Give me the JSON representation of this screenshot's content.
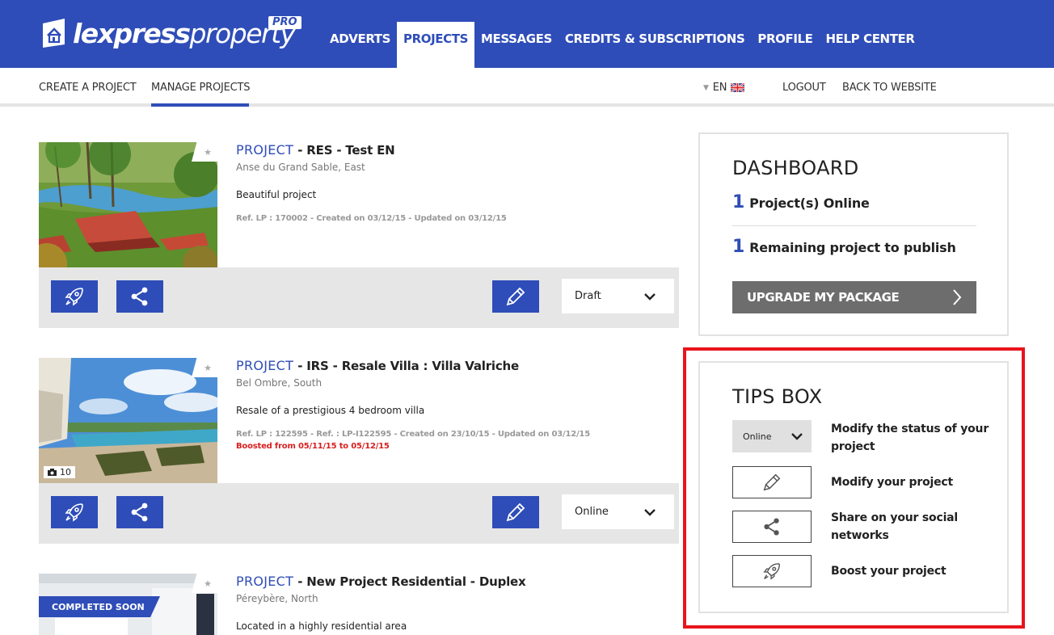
{
  "brand": {
    "name_part1": "lexpress",
    "name_part2": "property",
    "badge": "PRO",
    "icon": "house-logo-icon"
  },
  "main_nav": [
    {
      "label": "ADVERTS",
      "active": false
    },
    {
      "label": "PROJECTS",
      "active": true
    },
    {
      "label": "MESSAGES",
      "active": false
    },
    {
      "label": "CREDITS & SUBSCRIPTIONS",
      "active": false
    },
    {
      "label": "PROFILE",
      "active": false
    },
    {
      "label": "HELP CENTER",
      "active": false
    }
  ],
  "sub_nav": {
    "create": "CREATE A PROJECT",
    "manage": "MANAGE PROJECTS",
    "language": "EN",
    "logout": "LOGOUT",
    "back": "BACK TO WEBSITE"
  },
  "projects": [
    {
      "keyword": "PROJECT",
      "title": " - RES - Test EN",
      "location": "Anse du Grand Sable, East",
      "description": "Beautiful project",
      "ref": "Ref. LP : 170002 - Created on 03/12/15 - Updated on 03/12/15",
      "boost": "",
      "status": "Draft",
      "photo_count": "",
      "ribbon": ""
    },
    {
      "keyword": "PROJECT",
      "title": " - IRS - Resale Villa : Villa Valriche",
      "location": "Bel Ombre, South",
      "description": "Resale of a prestigious 4 bedroom villa",
      "ref": "Ref. LP : 122595 - Ref. : LP-I122595 - Created on 23/10/15 - Updated on 03/12/15",
      "boost": "Boosted from 05/11/15 to 05/12/15",
      "status": "Online",
      "photo_count": "10",
      "ribbon": ""
    },
    {
      "keyword": "PROJECT",
      "title": " - New Project Residential - Duplex",
      "location": "Péreybère, North",
      "description": "Located in a highly residential area",
      "ref": "",
      "boost": "",
      "status": "",
      "photo_count": "",
      "ribbon": "COMPLETED SOON"
    }
  ],
  "dashboard": {
    "title": "DASHBOARD",
    "online_count": "1",
    "online_label": "Project(s) Online",
    "remaining_count": "1",
    "remaining_label": "Remaining project to publish",
    "upgrade_label": "UPGRADE MY PACKAGE"
  },
  "tips": {
    "title": "TIPS BOX",
    "status_example": "Online",
    "items": [
      "Modify the status of your project",
      "Modify your project",
      "Share on your social networks",
      "Boost your project"
    ]
  },
  "colors": {
    "brand_blue": "#2f4db8",
    "alert_red": "#d81f1f",
    "highlight_red": "#e8141c",
    "upgrade_gray": "#6d6d6d"
  }
}
